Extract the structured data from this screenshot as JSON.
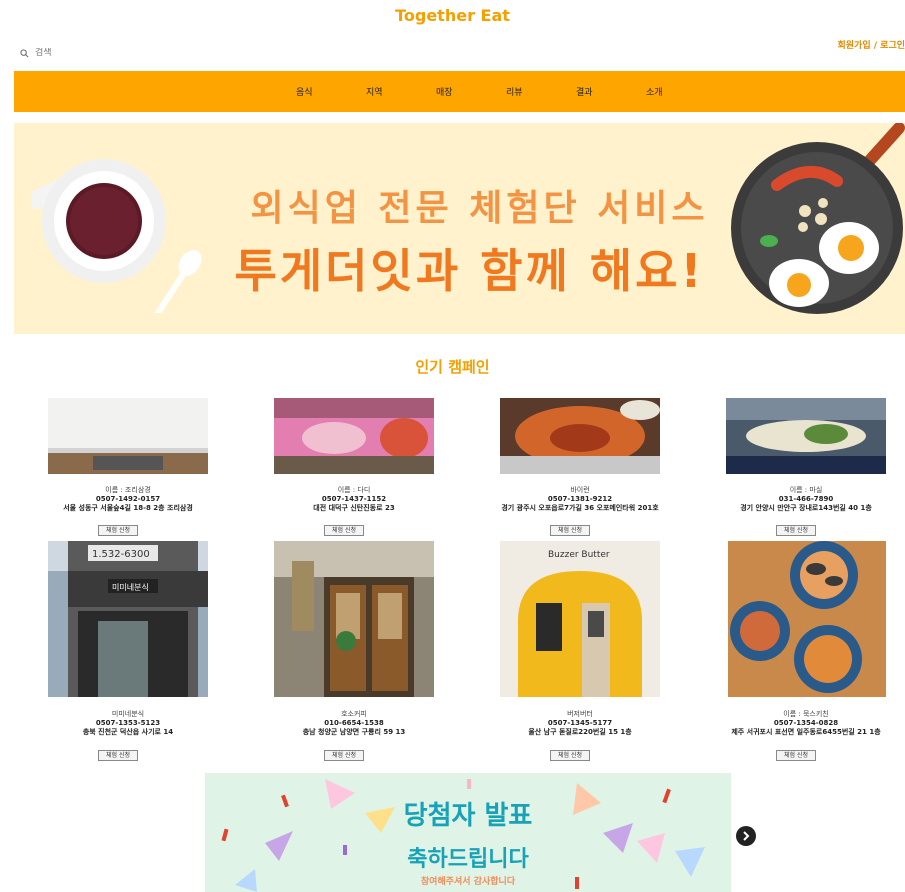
{
  "header": {
    "title": "Together Eat",
    "search_placeholder": "검색",
    "auth": "회원가입 / 로그인"
  },
  "nav": [
    "음식",
    "지역",
    "매장",
    "리뷰",
    "결과",
    "소개"
  ],
  "hero": {
    "line1": "외식업 전문 체험단 서비스",
    "line2": "투게더잇과 함께 해요!"
  },
  "section_title": "인기 캠페인",
  "campaigns": [
    {
      "name": "이름 : 조리삼경",
      "phone": "0507-1492-0157",
      "address": "서울 성동구 서울숲4길 18-8 2층 조리삼경",
      "button": "체험 신청"
    },
    {
      "name": "이름 : 다디",
      "phone": "0507-1437-1152",
      "address": "대전 대덕구 신탄진동로 23",
      "button": "체험 신청"
    },
    {
      "name": "바이런",
      "phone": "0507-1381-9212",
      "address": "경기 광주시 오포읍로7가길 36 오포메인타워 201호",
      "button": "체험 신청"
    },
    {
      "name": "이름 : 마실",
      "phone": "031-466-7890",
      "address": "경기 안양시 만안구 장내로143번길 40 1층",
      "button": "체험 신청"
    },
    {
      "name": "미미네분식",
      "phone": "0507-1353-5123",
      "address": "충북 진천군 덕산읍 사기로 14",
      "button": "체험 신청"
    },
    {
      "name": "호소커피",
      "phone": "010-6654-1538",
      "address": "충남 청양군 남양면 구룡리 59 13",
      "button": "체험 신청"
    },
    {
      "name": "버저버터",
      "phone": "0507-1345-5177",
      "address": "울산 남구 돋질로220번길 15 1층",
      "button": "체험 신청"
    },
    {
      "name": "이름 : 묵스키친",
      "phone": "0507-1354-0828",
      "address": "제주 서귀포시 표선면 일주동로6455번길 21 1층",
      "button": "체험 신청"
    }
  ],
  "sign_text": {
    "cafe": "Buzzer Butter",
    "snack": "미미네분식",
    "snack_phone": "1.532-6300"
  },
  "banner": {
    "title": "당첨자 발표",
    "subtitle": "축하드립니다",
    "note": "참여해주셔서 감사합니다"
  },
  "colors": {
    "accent": "#ffa500",
    "title": "#f5a000",
    "hero_bg": "#fff2cc",
    "banner_bg": "#dff4e6"
  }
}
